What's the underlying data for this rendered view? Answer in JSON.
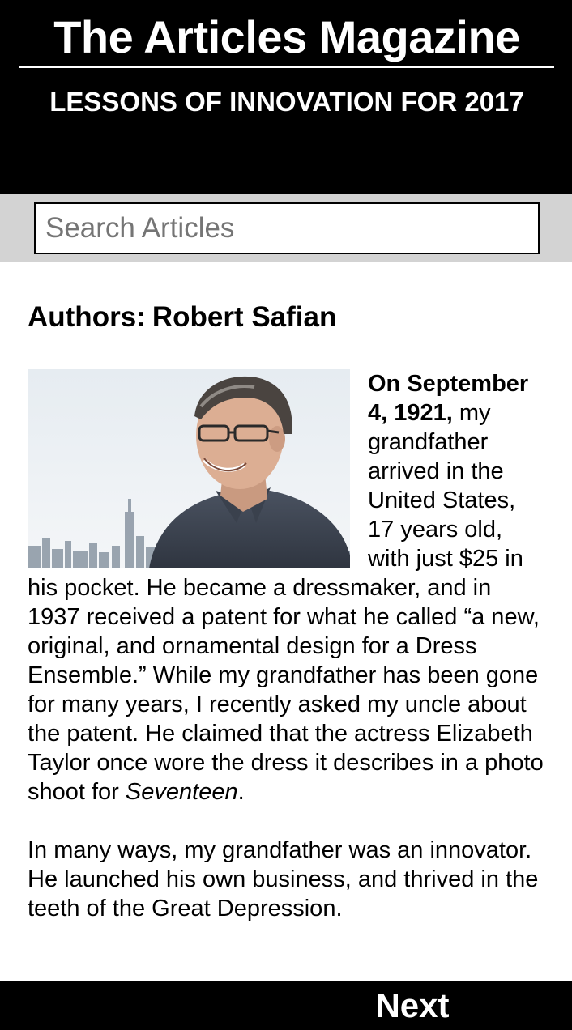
{
  "header": {
    "site_title": "The Articles Magazine",
    "issue_title": "LESSONS OF INNOVATION FOR 2017",
    "background_color": "#000000",
    "text_color": "#ffffff"
  },
  "search": {
    "placeholder": "Search Articles",
    "value": "",
    "bar_color": "#d3d3d3"
  },
  "article": {
    "authors_label": "Authors:",
    "authors_name": "Robert Safian",
    "photo_icon": "author-portrait-image",
    "lead_text": "On September 4, 1921,",
    "paragraph1": " my grandfather arrived in the United States, 17 years old, with just $25 in his pocket. He became a dressmaker, and in 1937 received a patent for what he called “a new, original, and ornamental design for a Dress Ensemble.” While my grandfather has been gone for many years, I recently asked my uncle about the patent. He claimed that the actress Elizabeth Taylor once wore the dress it describes in a photo shoot for ",
    "paragraph1_italic": "Seventeen",
    "paragraph1_end": ".",
    "paragraph2": "In many ways, my grandfather was an innovator. He launched his own business, and thrived in the teeth of the Great Depression."
  },
  "footer": {
    "next_label": "Next"
  }
}
